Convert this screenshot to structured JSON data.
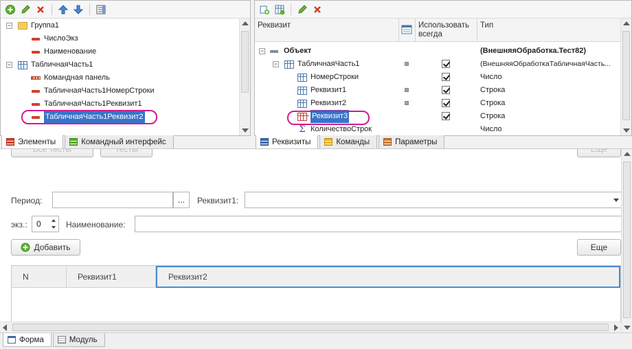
{
  "left_panel": {
    "tree": [
      {
        "label": "Группа1"
      },
      {
        "label": "ЧислоЭкз"
      },
      {
        "label": "Наименование"
      },
      {
        "label": "ТабличнаяЧасть1"
      },
      {
        "label": "Командная панель"
      },
      {
        "label": "ТабличнаяЧасть1НомерСтроки"
      },
      {
        "label": "ТабличнаяЧасть1Реквизит1"
      },
      {
        "label": "ТабличнаяЧасть1Реквизит2"
      }
    ],
    "tabs": [
      {
        "label": "Элементы"
      },
      {
        "label": "Командный интерфейс"
      }
    ]
  },
  "right_panel": {
    "columns": {
      "attr": "Реквизит",
      "use_always": "Использовать всегда",
      "type": "Тип"
    },
    "rows": [
      {
        "name": "Объект",
        "type": "(ВнешняяОбработка.Тест82)"
      },
      {
        "name": "ТабличнаяЧасть1",
        "type": "(ВнешняяОбработкаТабличнаяЧасть..."
      },
      {
        "name": "НомерСтроки",
        "type": "Число"
      },
      {
        "name": "Реквизит1",
        "type": "Строка"
      },
      {
        "name": "Реквизит2",
        "type": "Строка"
      },
      {
        "name": "Реквизит3",
        "type": "Строка"
      },
      {
        "name": "КоличествоСтрок",
        "type": "Число"
      }
    ],
    "tabs": [
      {
        "label": "Реквизиты"
      },
      {
        "label": "Команды"
      },
      {
        "label": "Параметры"
      }
    ]
  },
  "form": {
    "top_partial": {
      "all_tests": "Все тесты",
      "test": "Тесты",
      "more": "Еще"
    },
    "period_label": "Период:",
    "period_btn": "...",
    "attr1_label": "Реквизит1:",
    "ekz_label": "экз.:",
    "ekz_value": "0",
    "name_label": "Наименование:",
    "add_button": "Добавить",
    "more_button": "Еще",
    "grid_columns": [
      "N",
      "Реквизит1",
      "Реквизит2"
    ]
  },
  "bottom_tabs": [
    {
      "label": "Форма"
    },
    {
      "label": "Модуль"
    }
  ],
  "colors": {
    "highlight": "#d21b8f",
    "selection": "#3a73c9"
  }
}
